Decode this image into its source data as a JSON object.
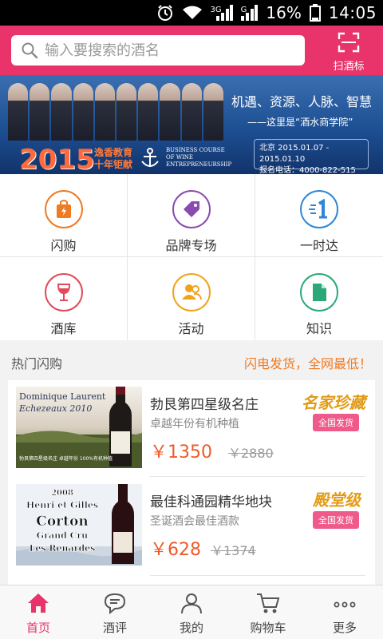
{
  "status_bar": {
    "network_1": "3G",
    "network_2": "G",
    "battery": "16%",
    "time": "14:05"
  },
  "header": {
    "search_placeholder": "输入要搜索的酒名",
    "scan_label": "扫酒标"
  },
  "banner": {
    "headline": "机遇、资源、人脉、智慧",
    "subline": "——这里是“酒水商学院”",
    "year": "2015",
    "org_line1": "逸香教育",
    "org_line2": "十年钜献",
    "course_line1": "BUSINESS COURSE",
    "course_line2": "OF WINE",
    "course_line3": "ENTREPRENEURSHIP",
    "dates": "北京 2015.01.07 - 2015.01.10",
    "phone": "报名电话：4000-822-515"
  },
  "grid": [
    {
      "label": "闪购",
      "icon": "flash-bag-icon",
      "color": "#f07a22"
    },
    {
      "label": "品牌专场",
      "icon": "tag-icon",
      "color": "#8a4ab0"
    },
    {
      "label": "一时达",
      "icon": "express-1-icon",
      "color": "#2f86d8"
    },
    {
      "label": "酒库",
      "icon": "wine-glass-icon",
      "color": "#e04a5a"
    },
    {
      "label": "活动",
      "icon": "people-icon",
      "color": "#f0a21a"
    },
    {
      "label": "知识",
      "icon": "document-icon",
      "color": "#2aa878"
    }
  ],
  "hot": {
    "title": "热门闪购",
    "slogan": "闪电发货，全网最低！"
  },
  "products": [
    {
      "name": "勃艮第四星级名庄",
      "desc": "卓越年份有机种植",
      "tag": "名家珍藏",
      "ship": "全国发货",
      "price": "￥1350",
      "orig": "￥2880",
      "img_line1": "Dominique Laurent",
      "img_line2": "Echezeaux 2010",
      "img_caption": "勃艮第四星级名庄 卓越年份 100%有机种植"
    },
    {
      "name": "最佳科通园精华地块",
      "desc": "圣诞酒会最佳酒款",
      "tag": "殿堂级",
      "ship": "全国发货",
      "price": "￥628",
      "orig": "￥1374",
      "img_line1": "2008",
      "img_line2": "Henri et Gilles",
      "img_line3": "Corton",
      "img_line4": "Grand Cru",
      "img_line5": "Les Renardes"
    }
  ],
  "nav": [
    {
      "label": "首页",
      "icon": "home-icon",
      "active": true
    },
    {
      "label": "酒评",
      "icon": "chat-icon",
      "active": false
    },
    {
      "label": "我的",
      "icon": "user-icon",
      "active": false
    },
    {
      "label": "购物车",
      "icon": "cart-icon",
      "active": false
    },
    {
      "label": "更多",
      "icon": "more-icon",
      "active": false
    }
  ],
  "colors": {
    "brand": "#e8346a",
    "accent_orange": "#f07a22",
    "price": "#ef5a2a",
    "tag_gold": "#e39a16"
  }
}
